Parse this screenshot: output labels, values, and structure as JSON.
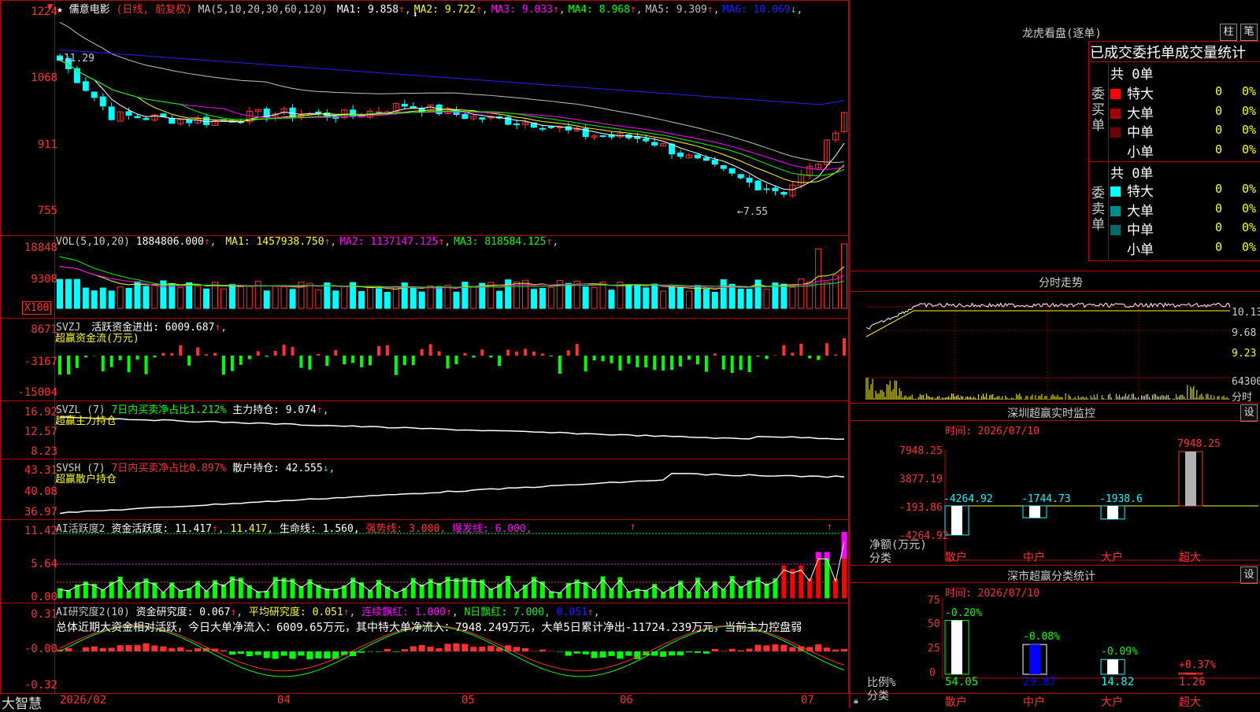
{
  "app": {
    "name": "大智慧"
  },
  "stock": {
    "star": "★",
    "name": "儒意电影",
    "period": "(日线, 前复权)"
  },
  "main_chart": {
    "ma_title": "MA(5,10,20,30,60,120)",
    "ma": [
      {
        "label": "MA1:",
        "value": "9.858",
        "arrow": "↑",
        "color": "#ffffff"
      },
      {
        "label": "MA2:",
        "value": "9.722",
        "arrow": "↑",
        "color": "#ffff00"
      },
      {
        "label": "MA3:",
        "value": "9.033",
        "arrow": "↑",
        "color": "#ff00ff"
      },
      {
        "label": "MA4:",
        "value": "8.968",
        "arrow": "↑",
        "color": "#00ff00"
      },
      {
        "label": "MA5:",
        "value": "9.309",
        "arrow": "↑",
        "color": "#c0c0c0"
      },
      {
        "label": "MA6:",
        "value": "10.069",
        "arrow": "↓",
        "color": "#2020ff"
      }
    ],
    "y_ticks": [
      "1224",
      "1068",
      "911",
      "755"
    ],
    "high_mark": "←11.29",
    "low_mark": "←7.55"
  },
  "vol": {
    "title": "VOL(5,10,20)",
    "value": "1884806.000",
    "ma": [
      {
        "label": "MA1:",
        "value": "1457938.750",
        "color": "#ffff00"
      },
      {
        "label": "MA2:",
        "value": "1137147.125",
        "color": "#ff00ff"
      },
      {
        "label": "MA3:",
        "value": "818584.125",
        "color": "#00ff00"
      }
    ],
    "y_ticks": [
      "18848",
      "9308"
    ],
    "unit": "X100"
  },
  "svzj": {
    "title": "SVZJ",
    "label": "活跃资金进出:",
    "value": "6009.687",
    "sub": "超赢资金流(万元)",
    "y_ticks": [
      "8671",
      "-3167",
      "-15004"
    ]
  },
  "svzl": {
    "title": "SVZL (7)",
    "desc": "7日内买卖净占比1.212%",
    "label": "主力持仓:",
    "value": "9.074",
    "sub": "超赢主力持仓",
    "y_ticks": [
      "16.92",
      "12.57",
      "8.23"
    ]
  },
  "svsh": {
    "title": "SVSH (7)",
    "desc": "7日内买卖净占比0.897%",
    "label": "散户持仓:",
    "value": "42.555",
    "sub": "超赢散户持仓",
    "y_ticks": [
      "43.31",
      "40.08",
      "36.97"
    ]
  },
  "ai_active": {
    "title": "AI活跃度2",
    "l1": "资金活跃度:",
    "v1": "11.417",
    "v2": "11.417,",
    "l3": "生命线:",
    "v3": "1.560,",
    "l4": "强势线:",
    "v4": "3.000,",
    "l5": "爆发线:",
    "v5": "6.000,",
    "y_ticks": [
      "11.42",
      "5.64",
      "0.00"
    ]
  },
  "ai_research": {
    "title": "AI研究度2(10)",
    "l1": "资金研究度:",
    "v1": "0.067",
    "l2": "平均研究度:",
    "v2": "0.051",
    "l3": "连续飘红:",
    "v3": "1.000",
    "l4": "N日飘红:",
    "v4": "7.000,",
    "v5": "0.051",
    "summary": "总体近期大资金相对活跃，今日大单净流入：6009.65万元，其中特大单净流入：7948.249万元，大单5日累计净出-11724.239万元，当前主力控盘弱",
    "y_ticks": [
      "0.31",
      "-0.00",
      "-0.32"
    ]
  },
  "x_axis": [
    "2026/02",
    "04",
    "05",
    "06",
    "07"
  ],
  "right": {
    "dragon_title": "龙虎看盘(逐单)",
    "btn1": "柱",
    "btn2": "笔",
    "stat_title": "已成交委托单成交量统计",
    "buy": {
      "side": "委买单",
      "total": "共 0单",
      "rows": [
        {
          "name": "特大",
          "v": "0",
          "p": "0%",
          "color": "#ff0000"
        },
        {
          "name": "大单",
          "v": "0",
          "p": "0%",
          "color": "#a00000"
        },
        {
          "name": "中单",
          "v": "0",
          "p": "0%",
          "color": "#700000"
        },
        {
          "name": "小单",
          "v": "0",
          "p": "0%",
          "color": "#000000"
        }
      ]
    },
    "sell": {
      "side": "委卖单",
      "total": "共 0单",
      "rows": [
        {
          "name": "特大",
          "v": "0",
          "p": "0%",
          "color": "#00ffff"
        },
        {
          "name": "大单",
          "v": "0",
          "p": "0%",
          "color": "#008b8b"
        },
        {
          "name": "中单",
          "v": "0",
          "p": "0%",
          "color": "#006a6a"
        },
        {
          "name": "小单",
          "v": "0",
          "p": "0%",
          "color": "#000000"
        }
      ]
    },
    "intraday_title": "分时走势",
    "intraday_ticks": [
      "10.13",
      "9.68",
      "9.23",
      "64300"
    ],
    "intraday_unit": "分时",
    "monitor": {
      "title": "深圳超赢实时监控",
      "set": "设",
      "time": "时间: 2026/07/10",
      "y_ticks": [
        "7948.25",
        "3877.19",
        "-193.86",
        "-4264.92"
      ],
      "cats": [
        "散户",
        "中户",
        "大户",
        "超大"
      ],
      "values": [
        "-4264.92",
        "-1744.73",
        "-1938.6",
        "7948.25"
      ],
      "unit": "净额(万元)",
      "unit2": "分类"
    },
    "category": {
      "title": "深市超赢分类统计",
      "set": "设",
      "time": "时间: 2026/07/10",
      "y_ticks": [
        "75",
        "50",
        "25",
        "0"
      ],
      "cats": [
        "散户",
        "中户",
        "大户",
        "超大"
      ],
      "pct": [
        "-0.20%",
        "-0.08%",
        "-0.09%",
        "+0.37%"
      ],
      "values": [
        "54.05",
        "29.87",
        "14.82",
        "1.26"
      ],
      "unit": "比例%",
      "unit2": "分类"
    }
  }
}
